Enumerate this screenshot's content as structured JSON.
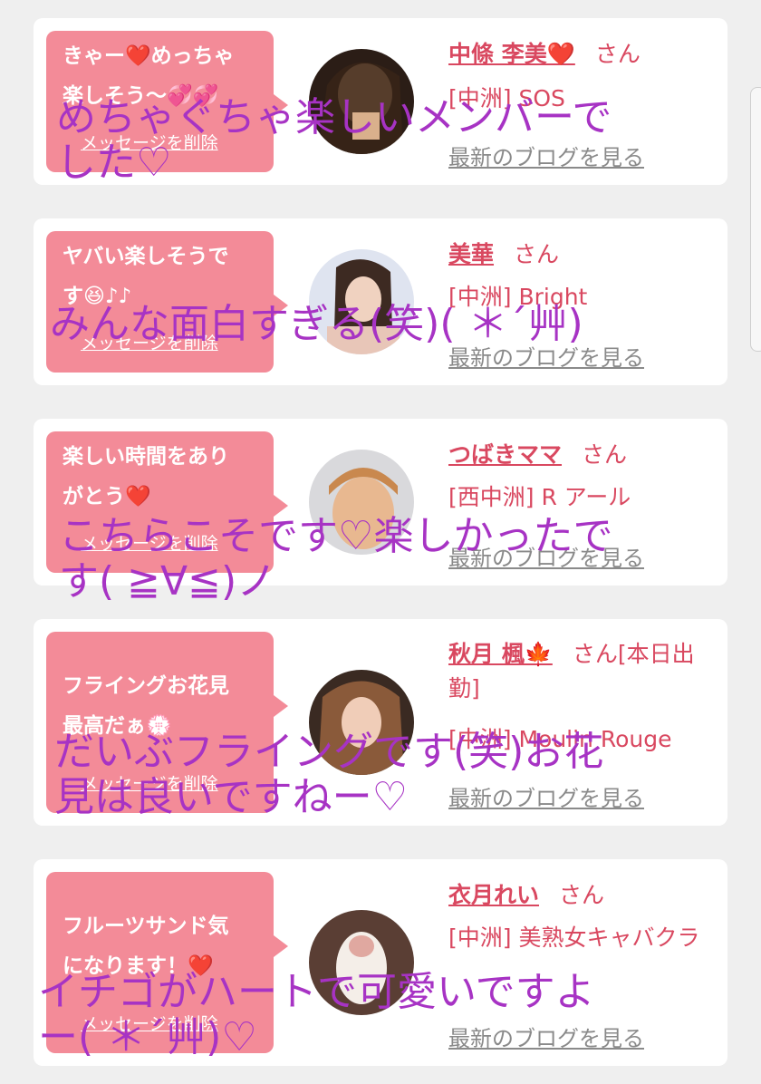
{
  "colors": {
    "background": "#efefef",
    "card": "#ffffff",
    "bubble": "#f38b98",
    "name": "#d94860",
    "link_gray": "#8a8a8a",
    "overlay_text": "#a733c4"
  },
  "delete_label": "メッセージを削除",
  "blog_label": "最新のブログを見る",
  "honorific": "さん",
  "messages": [
    {
      "bubble_lines": [
        "きゃー❤️めっちゃ",
        "楽しそう〜💞💞"
      ],
      "name": "中條 李美❤️",
      "shop": "[中洲] SOS",
      "overlay": [
        "めちゃぐちゃ楽しいメンバーで",
        "した♡"
      ]
    },
    {
      "bubble_lines": [
        "ヤバい楽しそうで",
        "す😆♪♪"
      ],
      "name": "美華",
      "shop": "[中洲] Bright",
      "overlay": [
        "みんな面白すぎる(笑)( ＊´艸)"
      ]
    },
    {
      "bubble_lines": [
        "楽しい時間をあり",
        "がとう❤️"
      ],
      "name": "つばきママ",
      "shop": "[西中洲] R アール",
      "overlay": [
        "こちらこそです♡楽しかったで",
        "す( ≧∀≦)ノ"
      ]
    },
    {
      "bubble_lines": [
        "フライングお花見",
        "最高だぁ💮"
      ],
      "name": "秋月 楓🍁",
      "name_suffix": "[本日出勤]",
      "shop": "[中洲] Moulin Rouge",
      "overlay": [
        "だいぶフライングです(笑)お花",
        "見は良いですねー♡"
      ]
    },
    {
      "bubble_lines": [
        "フルーツサンド気",
        "になります！❤️"
      ],
      "name": "衣月れい",
      "shop": "[中洲] 美熟女キャバクラ",
      "overlay": [
        "イチゴがハートで可愛いですよ",
        "ー( ＊´艸)♡"
      ]
    }
  ]
}
